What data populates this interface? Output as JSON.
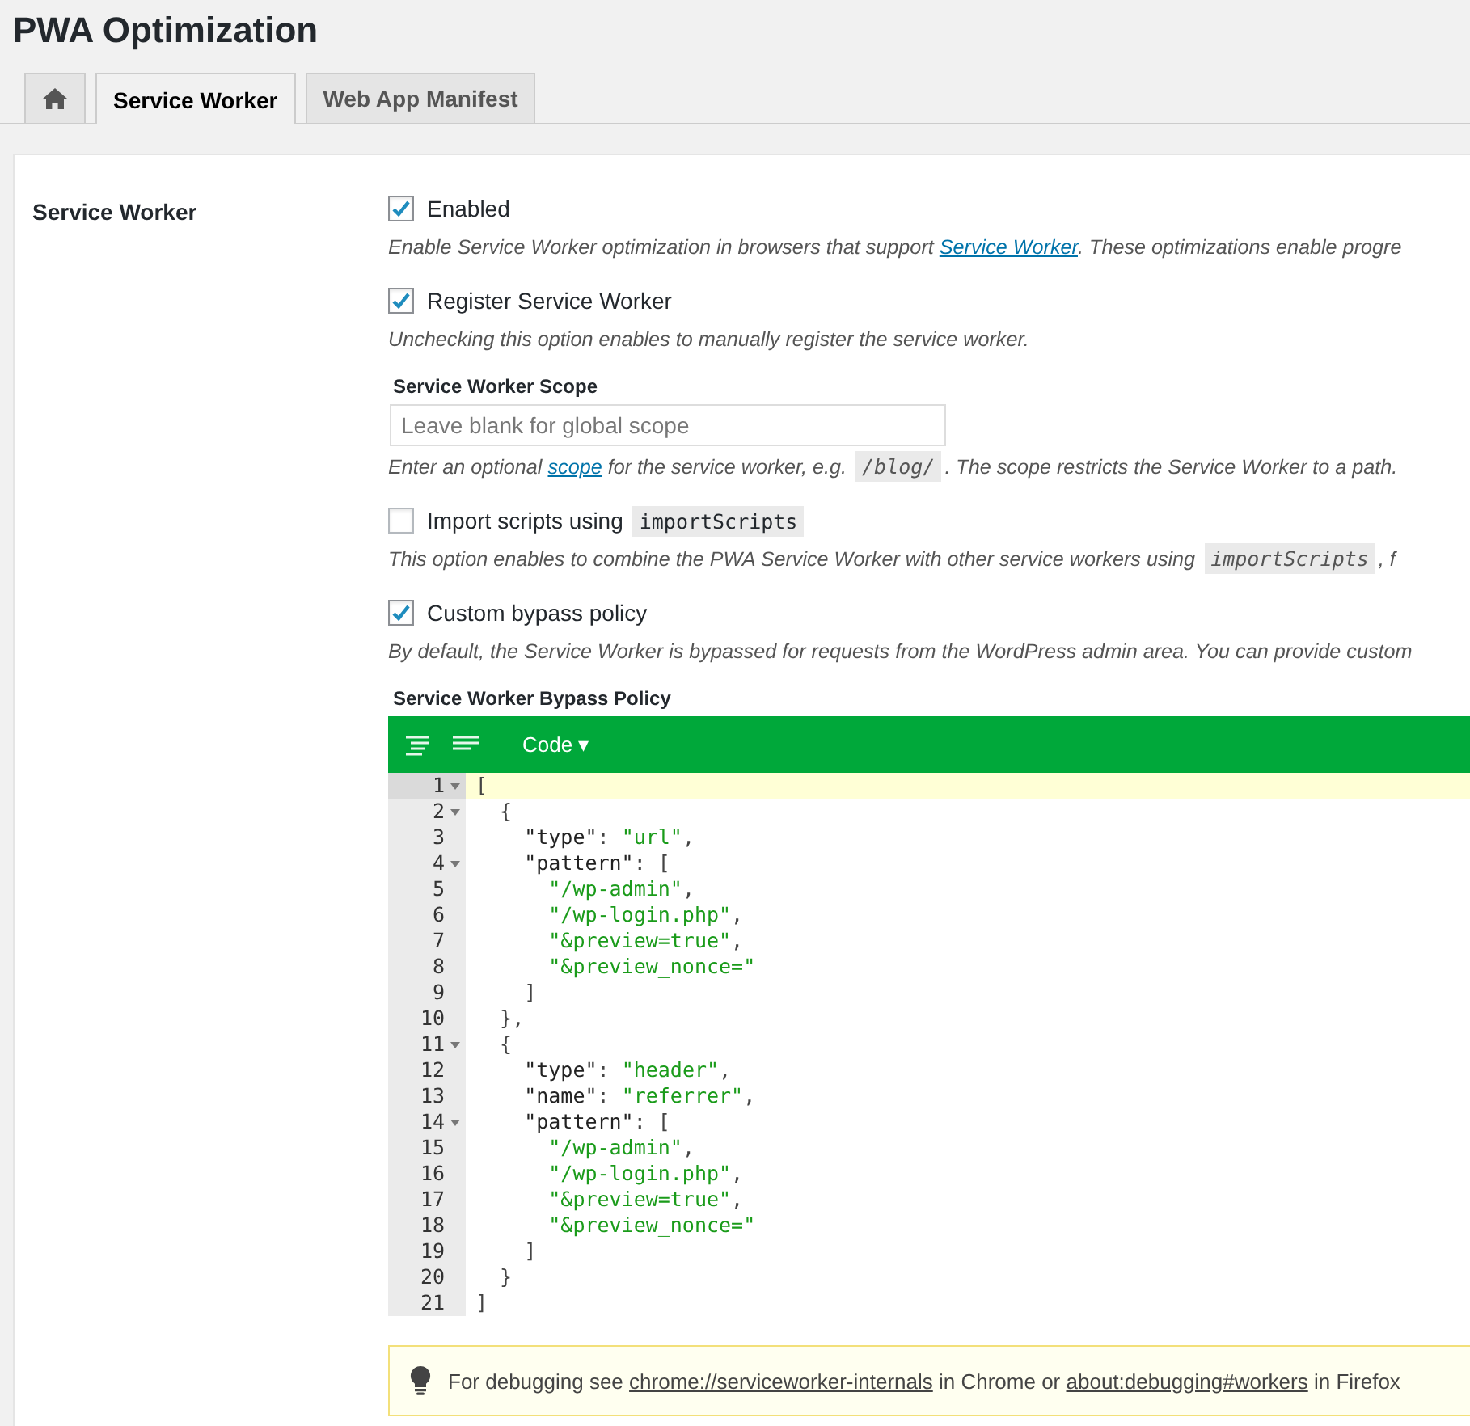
{
  "page": {
    "title": "PWA Optimization"
  },
  "tabs": [
    {
      "kind": "home",
      "selected": false
    },
    {
      "kind": "text",
      "label": "Service Worker",
      "selected": true
    },
    {
      "kind": "text",
      "label": "Web App Manifest",
      "selected": false
    }
  ],
  "section": {
    "label": "Service Worker"
  },
  "fields": [
    {
      "kind": "checkbox",
      "checked": true,
      "label": [
        {
          "kind": "text",
          "text": "Enabled"
        }
      ],
      "description": [
        {
          "kind": "text",
          "text": "Enable Service Worker optimization in browsers that support "
        },
        {
          "kind": "link",
          "text": "Service Worker"
        },
        {
          "kind": "text",
          "text": ". These optimizations enable progre"
        }
      ]
    },
    {
      "kind": "checkbox",
      "checked": true,
      "label": [
        {
          "kind": "text",
          "text": "Register Service Worker"
        }
      ],
      "description": [
        {
          "kind": "text",
          "text": "Unchecking this option enables to manually register the service worker."
        }
      ]
    },
    {
      "kind": "text_input",
      "label": "Service Worker Scope",
      "placeholder": "Leave blank for global scope",
      "description": [
        {
          "kind": "text",
          "text": "Enter an optional "
        },
        {
          "kind": "link",
          "text": "scope"
        },
        {
          "kind": "text",
          "text": " for the service worker, e.g. "
        },
        {
          "kind": "code",
          "text": "/blog/"
        },
        {
          "kind": "text",
          "text": ". The scope restricts the Service Worker to a path."
        }
      ]
    },
    {
      "kind": "checkbox",
      "checked": false,
      "label": [
        {
          "kind": "text",
          "text": "Import scripts using"
        },
        {
          "kind": "code",
          "text": "importScripts"
        }
      ],
      "description": [
        {
          "kind": "text",
          "text": "This option enables to combine the PWA Service Worker with other service workers using "
        },
        {
          "kind": "code",
          "text": "importScripts"
        },
        {
          "kind": "text",
          "text": ", f"
        }
      ]
    },
    {
      "kind": "checkbox",
      "checked": true,
      "label": [
        {
          "kind": "text",
          "text": "Custom bypass policy"
        }
      ],
      "description": [
        {
          "kind": "text",
          "text": "By default, the Service Worker is bypassed for requests from the WordPress admin area. You can provide custom"
        }
      ]
    },
    {
      "kind": "code_editor",
      "label": "Service Worker Bypass Policy",
      "mode": "Code ▾",
      "lines": [
        {
          "number": "1",
          "fold": true,
          "active": true,
          "tokens": [
            {
              "kind": "punct",
              "text": "["
            }
          ]
        },
        {
          "number": "2",
          "fold": true,
          "active": false,
          "tokens": [
            {
              "kind": "punct",
              "text": "  {"
            }
          ]
        },
        {
          "number": "3",
          "fold": false,
          "active": false,
          "tokens": [
            {
              "kind": "key",
              "text": "    \"type\""
            },
            {
              "kind": "punct",
              "text": ": "
            },
            {
              "kind": "string",
              "text": "\"url\""
            },
            {
              "kind": "punct",
              "text": ","
            }
          ]
        },
        {
          "number": "4",
          "fold": true,
          "active": false,
          "tokens": [
            {
              "kind": "key",
              "text": "    \"pattern\""
            },
            {
              "kind": "punct",
              "text": ": ["
            }
          ]
        },
        {
          "number": "5",
          "fold": false,
          "active": false,
          "tokens": [
            {
              "kind": "string",
              "text": "      \"/wp-admin\""
            },
            {
              "kind": "punct",
              "text": ","
            }
          ]
        },
        {
          "number": "6",
          "fold": false,
          "active": false,
          "tokens": [
            {
              "kind": "string",
              "text": "      \"/wp-login.php\""
            },
            {
              "kind": "punct",
              "text": ","
            }
          ]
        },
        {
          "number": "7",
          "fold": false,
          "active": false,
          "tokens": [
            {
              "kind": "string",
              "text": "      \"&preview=true\""
            },
            {
              "kind": "punct",
              "text": ","
            }
          ]
        },
        {
          "number": "8",
          "fold": false,
          "active": false,
          "tokens": [
            {
              "kind": "string",
              "text": "      \"&preview_nonce=\""
            }
          ]
        },
        {
          "number": "9",
          "fold": false,
          "active": false,
          "tokens": [
            {
              "kind": "punct",
              "text": "    ]"
            }
          ]
        },
        {
          "number": "10",
          "fold": false,
          "active": false,
          "tokens": [
            {
              "kind": "punct",
              "text": "  },"
            }
          ]
        },
        {
          "number": "11",
          "fold": true,
          "active": false,
          "tokens": [
            {
              "kind": "punct",
              "text": "  {"
            }
          ]
        },
        {
          "number": "12",
          "fold": false,
          "active": false,
          "tokens": [
            {
              "kind": "key",
              "text": "    \"type\""
            },
            {
              "kind": "punct",
              "text": ": "
            },
            {
              "kind": "string",
              "text": "\"header\""
            },
            {
              "kind": "punct",
              "text": ","
            }
          ]
        },
        {
          "number": "13",
          "fold": false,
          "active": false,
          "tokens": [
            {
              "kind": "key",
              "text": "    \"name\""
            },
            {
              "kind": "punct",
              "text": ": "
            },
            {
              "kind": "string",
              "text": "\"referrer\""
            },
            {
              "kind": "punct",
              "text": ","
            }
          ]
        },
        {
          "number": "14",
          "fold": true,
          "active": false,
          "tokens": [
            {
              "kind": "key",
              "text": "    \"pattern\""
            },
            {
              "kind": "punct",
              "text": ": ["
            }
          ]
        },
        {
          "number": "15",
          "fold": false,
          "active": false,
          "tokens": [
            {
              "kind": "string",
              "text": "      \"/wp-admin\""
            },
            {
              "kind": "punct",
              "text": ","
            }
          ]
        },
        {
          "number": "16",
          "fold": false,
          "active": false,
          "tokens": [
            {
              "kind": "string",
              "text": "      \"/wp-login.php\""
            },
            {
              "kind": "punct",
              "text": ","
            }
          ]
        },
        {
          "number": "17",
          "fold": false,
          "active": false,
          "tokens": [
            {
              "kind": "string",
              "text": "      \"&preview=true\""
            },
            {
              "kind": "punct",
              "text": ","
            }
          ]
        },
        {
          "number": "18",
          "fold": false,
          "active": false,
          "tokens": [
            {
              "kind": "string",
              "text": "      \"&preview_nonce=\""
            }
          ]
        },
        {
          "number": "19",
          "fold": false,
          "active": false,
          "tokens": [
            {
              "kind": "punct",
              "text": "    ]"
            }
          ]
        },
        {
          "number": "20",
          "fold": false,
          "active": false,
          "tokens": [
            {
              "kind": "punct",
              "text": "  }"
            }
          ]
        },
        {
          "number": "21",
          "fold": false,
          "active": false,
          "tokens": [
            {
              "kind": "punct",
              "text": "]"
            }
          ]
        }
      ]
    }
  ],
  "notice": {
    "parts": [
      {
        "kind": "text",
        "text": "For debugging see "
      },
      {
        "kind": "link",
        "text": "chrome://serviceworker-internals"
      },
      {
        "kind": "text",
        "text": " in Chrome or "
      },
      {
        "kind": "link",
        "text": "about:debugging#workers"
      },
      {
        "kind": "text",
        "text": " in Firefox"
      }
    ]
  }
}
